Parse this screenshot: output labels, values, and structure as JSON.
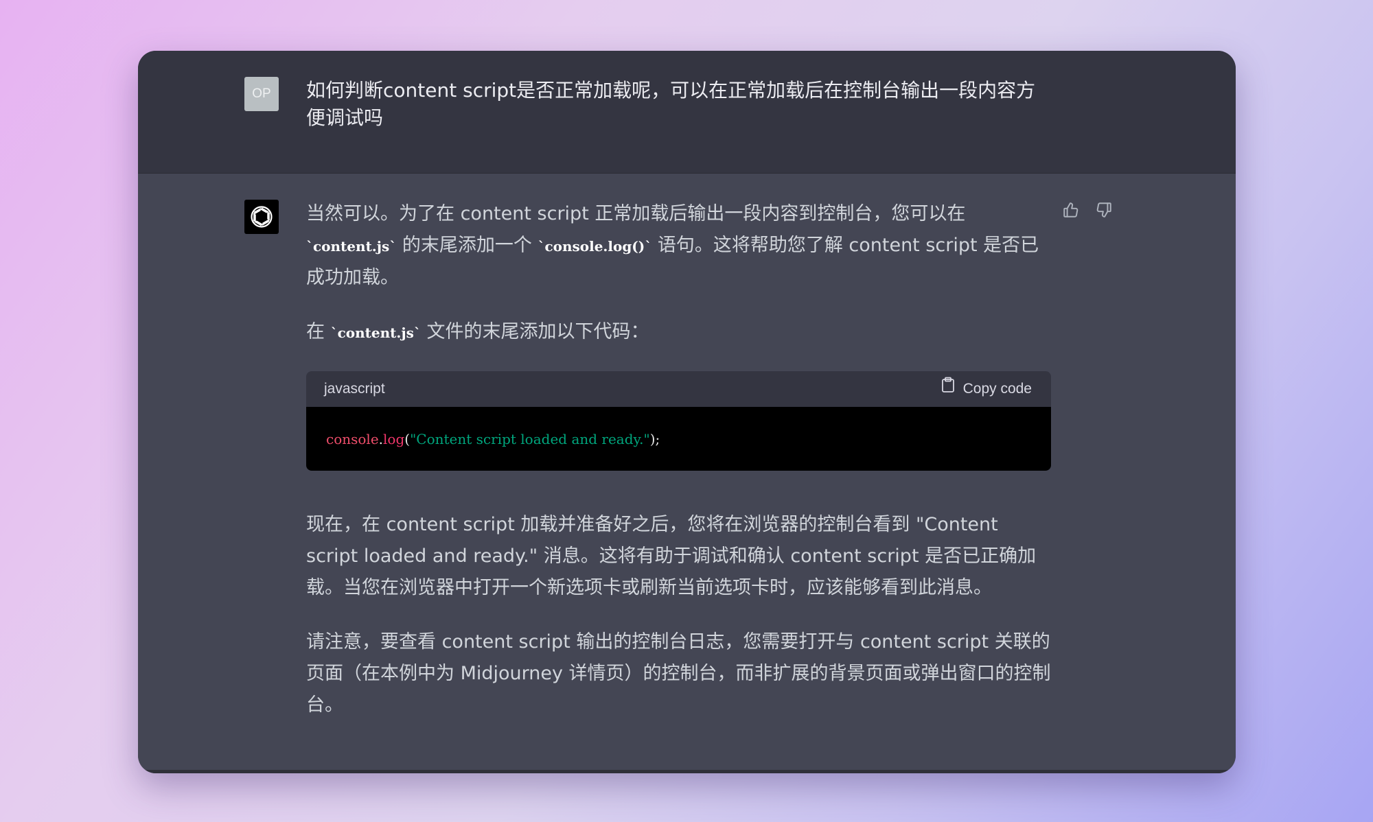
{
  "user": {
    "avatar_initials": "OP",
    "message": "如何判断content script是否正常加载呢，可以在正常加载后在控制台输出一段内容方便调试吗"
  },
  "assistant": {
    "para1": {
      "t1": "当然可以。为了在 content script 正常加载后输出一段内容到控制台，您可以在 ",
      "c1": "`content.js`",
      "t2": " 的末尾添加一个 ",
      "c2": "`console.log()`",
      "t3": " 语句。这将帮助您了解 content script 是否已成功加载。"
    },
    "para2": {
      "t1": "在 ",
      "c1": "`content.js`",
      "t2": " 文件的末尾添加以下代码："
    },
    "code_block": {
      "language": "javascript",
      "copy_label": "Copy code",
      "tokens": {
        "object": "console",
        "dot": ".",
        "method": "log",
        "open": "(",
        "string": "\"Content script loaded and ready.\"",
        "close": ");"
      }
    },
    "para3": "现在，在 content script 加载并准备好之后，您将在浏览器的控制台看到 \"Content script loaded and ready.\" 消息。这将有助于调试和确认 content script 是否已正确加载。当您在浏览器中打开一个新选项卡或刷新当前选项卡时，应该能够看到此消息。",
    "para4": "请注意，要查看 content script 输出的控制台日志，您需要打开与 content script 关联的页面（在本例中为 Midjourney 详情页）的控制台，而非扩展的背景页面或弹出窗口的控制台。"
  },
  "icons": {
    "assistant_avatar": "openai-logo-icon",
    "thumbs_up": "thumbs-up-icon",
    "thumbs_down": "thumbs-down-icon",
    "copy": "clipboard-icon"
  },
  "colors": {
    "user_bg": "#343541",
    "assistant_bg": "#444654",
    "code_header_bg": "#343541",
    "code_bg": "#000000",
    "string_color": "#00a67d",
    "keyword_color": "#ef4e6b"
  }
}
